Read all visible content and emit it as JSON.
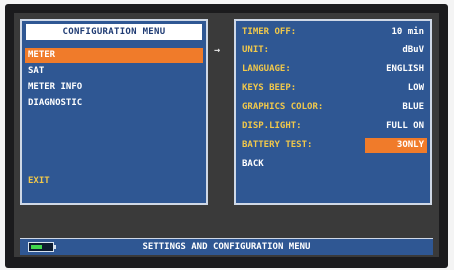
{
  "left_menu": {
    "title": "CONFIGURATION MENU",
    "items": [
      "METER",
      "SAT",
      "METER INFO",
      "DIAGNOSTIC"
    ],
    "exit": "EXIT"
  },
  "arrow": "→",
  "settings": {
    "rows": [
      {
        "label": "TIMER OFF:",
        "value": "10 min"
      },
      {
        "label": "UNIT:",
        "value": "dBuV"
      },
      {
        "label": "LANGUAGE:",
        "value": "ENGLISH"
      },
      {
        "label": "KEYS BEEP:",
        "value": "LOW"
      },
      {
        "label": "GRAPHICS COLOR:",
        "value": "BLUE"
      },
      {
        "label": "DISP.LIGHT:",
        "value": "FULL ON"
      },
      {
        "label": "BATTERY TEST:",
        "value": "3ONLY"
      }
    ],
    "back": "BACK"
  },
  "status_bar": {
    "text": "SETTINGS AND CONFIGURATION MENU",
    "battery_level": 0.55
  },
  "colors": {
    "panel": "#2f5793",
    "highlight": "#f07b2a",
    "label_yellow": "#f1c84a"
  }
}
